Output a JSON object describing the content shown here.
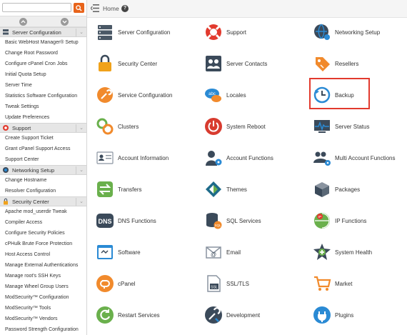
{
  "search": {
    "value": "",
    "placeholder": ""
  },
  "breadcrumb": {
    "home": "Home"
  },
  "sidebar": {
    "sections": [
      {
        "title": "Server Configuration",
        "icon": "server-config-icon",
        "items": [
          "Basic WebHost Manager® Setup",
          "Change Root Password",
          "Configure cPanel Cron Jobs",
          "Initial Quota Setup",
          "Server Time",
          "Statistics Software Configuration",
          "Tweak Settings",
          "Update Preferences"
        ]
      },
      {
        "title": "Support",
        "icon": "support-icon",
        "items": [
          "Create Support Ticket",
          "Grant cPanel Support Access",
          "Support Center"
        ]
      },
      {
        "title": "Networking Setup",
        "icon": "networking-icon",
        "items": [
          "Change Hostname",
          "Resolver Configuration"
        ]
      },
      {
        "title": "Security Center",
        "icon": "security-icon",
        "items": [
          "Apache mod_userdir Tweak",
          "Compiler Access",
          "Configure Security Policies",
          "cPHulk Brute Force Protection",
          "Host Access Control",
          "Manage External Authentications",
          "Manage root's SSH Keys",
          "Manage Wheel Group Users",
          "ModSecurity™ Configuration",
          "ModSecurity™ Tools",
          "ModSecurity™ Vendors",
          "Password Strength Configuration"
        ]
      }
    ]
  },
  "grid": [
    [
      "Server Configuration",
      "Support",
      "Networking Setup"
    ],
    [
      "Security Center",
      "Server Contacts",
      "Resellers"
    ],
    [
      "Service Configuration",
      "Locales",
      "Backup"
    ],
    [
      "Clusters",
      "System Reboot",
      "Server Status"
    ],
    [
      "Account Information",
      "Account Functions",
      "Multi Account Functions"
    ],
    [
      "Transfers",
      "Themes",
      "Packages"
    ],
    [
      "DNS Functions",
      "SQL Services",
      "IP Functions"
    ],
    [
      "Software",
      "Email",
      "System Health"
    ],
    [
      "cPanel",
      "SSL/TLS",
      "Market"
    ],
    [
      "Restart Services",
      "Development",
      "Plugins"
    ]
  ],
  "icon_text": {
    "dns": "DNS",
    "ssl": "SSL",
    "sql": "SQL",
    "locales": "abc",
    "ip": "IP"
  },
  "highlighted_item": "Backup",
  "colors": {
    "accent": "#e8641b",
    "highlight_border": "#e23a2e",
    "icon_dark": "#3b4a5a",
    "orange": "#f18a2c",
    "green": "#6ab04c",
    "blue": "#2a8ad4",
    "red": "#d83b2f"
  }
}
